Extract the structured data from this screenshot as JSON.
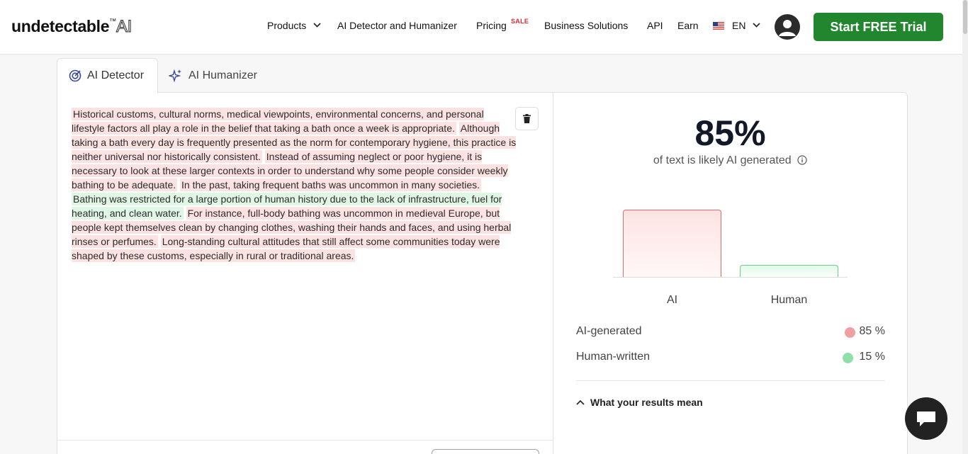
{
  "header": {
    "logo_main": "undetectable",
    "logo_tm": "™",
    "logo_ai": "AI",
    "nav": {
      "products": "Products",
      "detector_humanizer": "AI Detector and Humanizer",
      "pricing": "Pricing",
      "sale": "SALE",
      "business": "Business Solutions",
      "api": "API",
      "earn": "Earn",
      "language": "EN"
    },
    "cta": "Start FREE Trial"
  },
  "tabs": [
    {
      "label": "AI Detector",
      "active": true
    },
    {
      "label": "AI Humanizer",
      "active": false
    }
  ],
  "input_text": {
    "segments": [
      {
        "text": "Historical customs, cultural norms, medical viewpoints, environmental concerns, and personal lifestyle factors all play a role in the belief that taking a bath once a week is appropriate.",
        "type": "ai"
      },
      {
        "text": "Although taking a bath every day is frequently presented as the norm for contemporary hygiene, this practice is neither universal nor historically consistent.",
        "type": "ai"
      },
      {
        "text": "Instead of assuming neglect or poor hygiene, it is necessary to look at these larger contexts in order to understand why some people consider weekly bathing to be adequate.",
        "type": "ai"
      },
      {
        "text": "In the past, taking frequent baths was uncommon in many societies.",
        "type": "ai"
      },
      {
        "text": "Bathing was restricted for a large portion of human history due to the lack of infrastructure, fuel for heating, and clean water.",
        "type": "human"
      },
      {
        "text": "For instance, full-body bathing was uncommon in medieval Europe, but people kept themselves clean by changing clothes, washing their hands and faces, and using herbal rinses or perfumes.",
        "type": "ai"
      },
      {
        "text": "Long-standing cultural attitudes that still affect some communities today were shaped by these customs, especially in rural or traditional areas.",
        "type": "ai"
      }
    ]
  },
  "results": {
    "percent": "85%",
    "caption": "of text is likely AI generated",
    "chart_data": {
      "type": "bar",
      "categories": [
        "AI",
        "Human"
      ],
      "values": [
        85,
        15
      ],
      "ylim": [
        0,
        100
      ],
      "colors": [
        "#e46a6a",
        "#6ccf8a"
      ]
    },
    "stats": [
      {
        "label": "AI-generated",
        "value": "85 %",
        "color": "#f0a0a0"
      },
      {
        "label": "Human-written",
        "value": "15 %",
        "color": "#8fe0a8"
      }
    ],
    "results_mean": "What your results mean"
  },
  "colors": {
    "cta": "#21862e",
    "ai_highlight": "#fde2e2",
    "human_highlight": "#e0f7e6"
  }
}
